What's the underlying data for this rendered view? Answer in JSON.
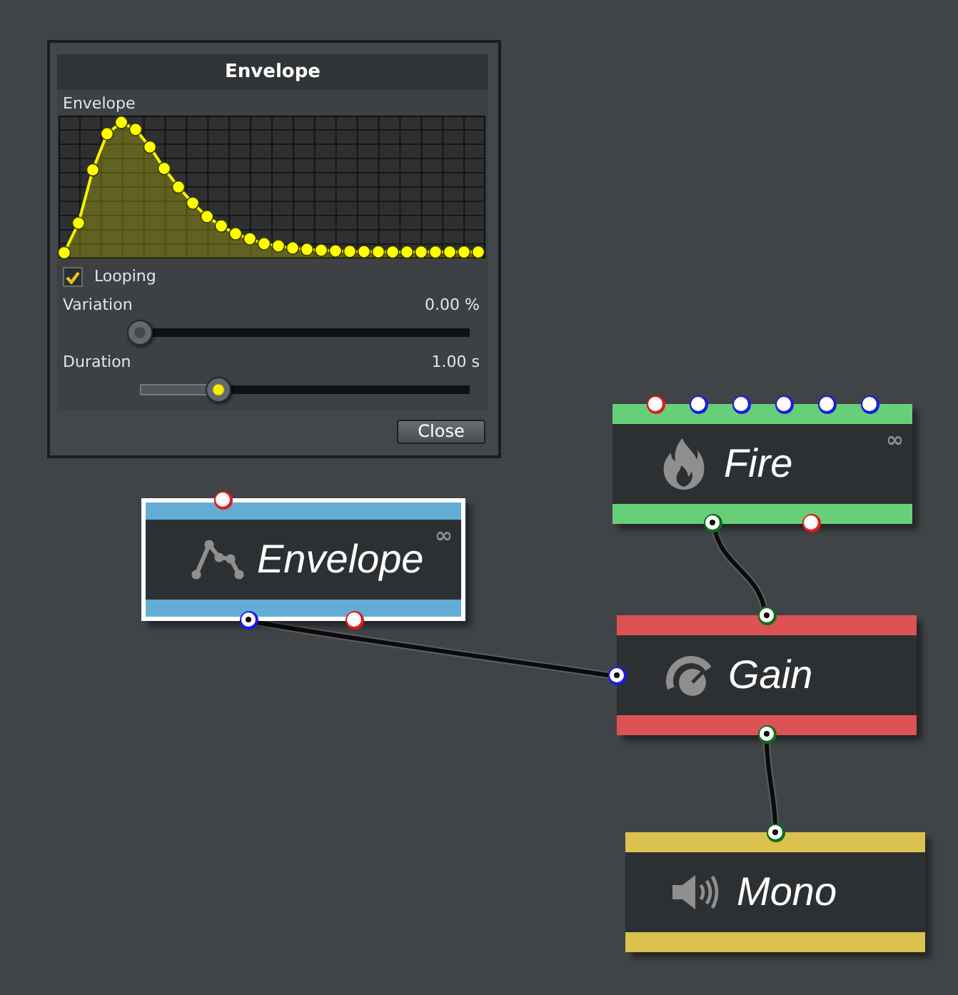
{
  "dialog": {
    "title": "Envelope",
    "graph_label": "Envelope",
    "looping": {
      "label": "Looping",
      "checked": true
    },
    "sliders": [
      {
        "label": "Variation",
        "reading": "0.00 %",
        "level": 0,
        "highlighted": false
      },
      {
        "label": "Duration",
        "reading": "1.00 s",
        "level": 0.24,
        "highlighted": true
      }
    ],
    "close_button": "Close"
  },
  "nodes": [
    {
      "kind": "fire",
      "label": "Fire",
      "badge": "∞",
      "color": "#68cf79",
      "selected": false,
      "top_ports": [
        {
          "color": "#e21b1b",
          "connected": false
        },
        {
          "color": "#1a1ae6",
          "connected": false
        },
        {
          "color": "#1a1ae6",
          "connected": false
        },
        {
          "color": "#1a1ae6",
          "connected": false
        },
        {
          "color": "#1a1ae6",
          "connected": false
        },
        {
          "color": "#1a1ae6",
          "connected": false
        }
      ],
      "bottom_ports": [
        {
          "color": "#0d6e1d",
          "connected": true
        },
        {
          "color": "#e21b1b",
          "connected": false
        }
      ]
    },
    {
      "kind": "envelope",
      "label": "Envelope",
      "badge": "∞",
      "color": "#63add4",
      "selected": true,
      "top_ports": [
        {
          "color": "#e21b1b",
          "connected": false
        }
      ],
      "bottom_ports": [
        {
          "color": "#1a1ae6",
          "connected": true
        },
        {
          "color": "#e21b1b",
          "connected": false
        }
      ]
    },
    {
      "kind": "gain",
      "label": "Gain",
      "color": "#dc5353",
      "selected": false,
      "top_ports": [
        {
          "color": "#0d6e1d",
          "connected": true
        }
      ],
      "left_ports": [
        {
          "color": "#1a1ae6",
          "connected": true
        }
      ],
      "bottom_ports": [
        {
          "color": "#0d6e1d",
          "connected": true
        }
      ]
    },
    {
      "kind": "mono",
      "label": "Mono",
      "color": "#dbc24e",
      "selected": false,
      "top_ports": [
        {
          "color": "#0d6e1d",
          "connected": true
        }
      ]
    }
  ]
}
